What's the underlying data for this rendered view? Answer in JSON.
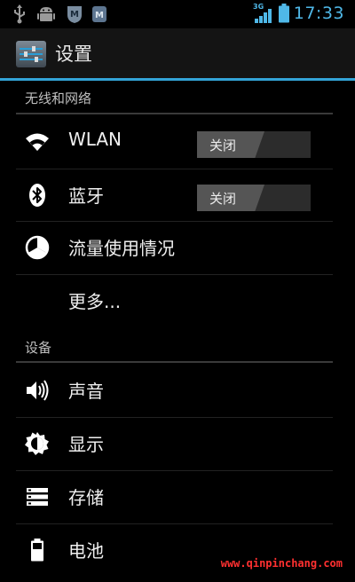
{
  "status_bar": {
    "time": "17:33",
    "network": "3G",
    "icons": [
      "usb-icon",
      "android-debug-icon",
      "app-notification-icon",
      "app-notification-icon",
      "signal-icon",
      "battery-icon"
    ]
  },
  "action_bar": {
    "title": "设置",
    "icon": "settings-sliders-icon"
  },
  "sections": [
    {
      "header": "无线和网络",
      "items": [
        {
          "label": "WLAN",
          "icon": "wifi-icon",
          "switch": "关闭"
        },
        {
          "label": "蓝牙",
          "icon": "bluetooth-icon",
          "switch": "关闭"
        },
        {
          "label": "流量使用情况",
          "icon": "data-usage-icon"
        },
        {
          "label": "更多..."
        }
      ]
    },
    {
      "header": "设备",
      "items": [
        {
          "label": "声音",
          "icon": "volume-icon"
        },
        {
          "label": "显示",
          "icon": "brightness-icon"
        },
        {
          "label": "存储",
          "icon": "storage-icon"
        },
        {
          "label": "电池",
          "icon": "battery-icon"
        }
      ]
    }
  ],
  "watermark": "www.qinpinchang.com",
  "colors": {
    "accent": "#33a4d8",
    "time": "#4fb8e8",
    "watermark": "#ff3030"
  }
}
